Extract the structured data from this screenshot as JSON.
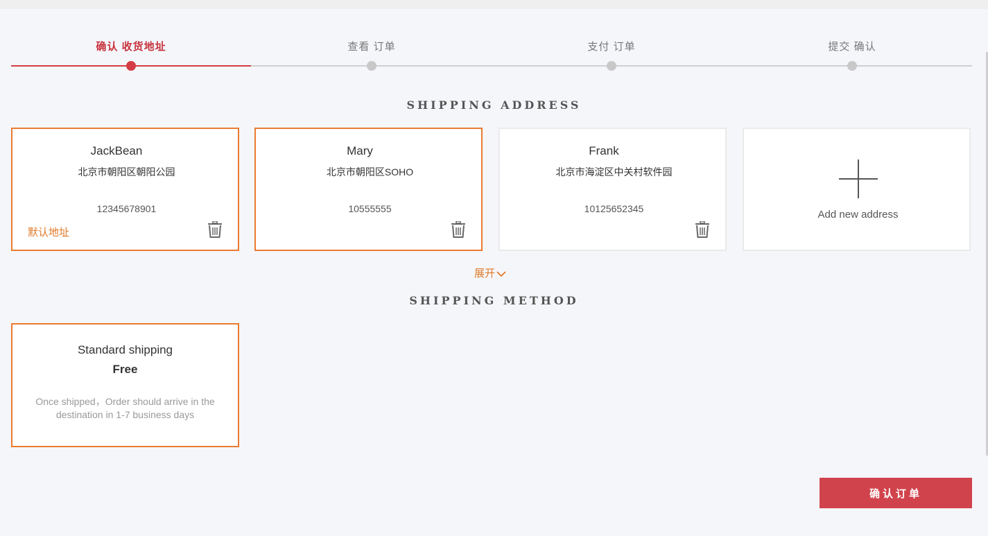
{
  "stepper": {
    "steps": [
      {
        "label": "确认 收货地址",
        "active": true
      },
      {
        "label": "查看 订单",
        "active": false
      },
      {
        "label": "支付 订单",
        "active": false
      },
      {
        "label": "提交 确认",
        "active": false
      }
    ]
  },
  "address_section": {
    "title": "SHIPPING ADDRESS",
    "addresses": [
      {
        "name": "JackBean",
        "address": "北京市朝阳区朝阳公园",
        "phone": "12345678901",
        "default_label": "默认地址",
        "selected": true
      },
      {
        "name": "Mary",
        "address": "北京市朝阳区SOHO",
        "phone": "10555555",
        "default_label": "",
        "selected": true
      },
      {
        "name": "Frank",
        "address": "北京市海淀区中关村软件园",
        "phone": "10125652345",
        "default_label": "",
        "selected": false
      }
    ],
    "add_label": "Add new address",
    "expand_label": "展开"
  },
  "method_section": {
    "title": "SHIPPING METHOD",
    "method": {
      "name": "Standard shipping",
      "price": "Free",
      "description": "Once shipped，Order should arrive in the destination in 1-7 business days"
    }
  },
  "actions": {
    "confirm_label": "确认订单"
  },
  "colors": {
    "accent_red": "#d1434c",
    "accent_orange": "#ea7a2e"
  },
  "icons": {
    "delete": "trash-icon",
    "add": "plus-icon",
    "expand": "chevron-down-icon"
  }
}
